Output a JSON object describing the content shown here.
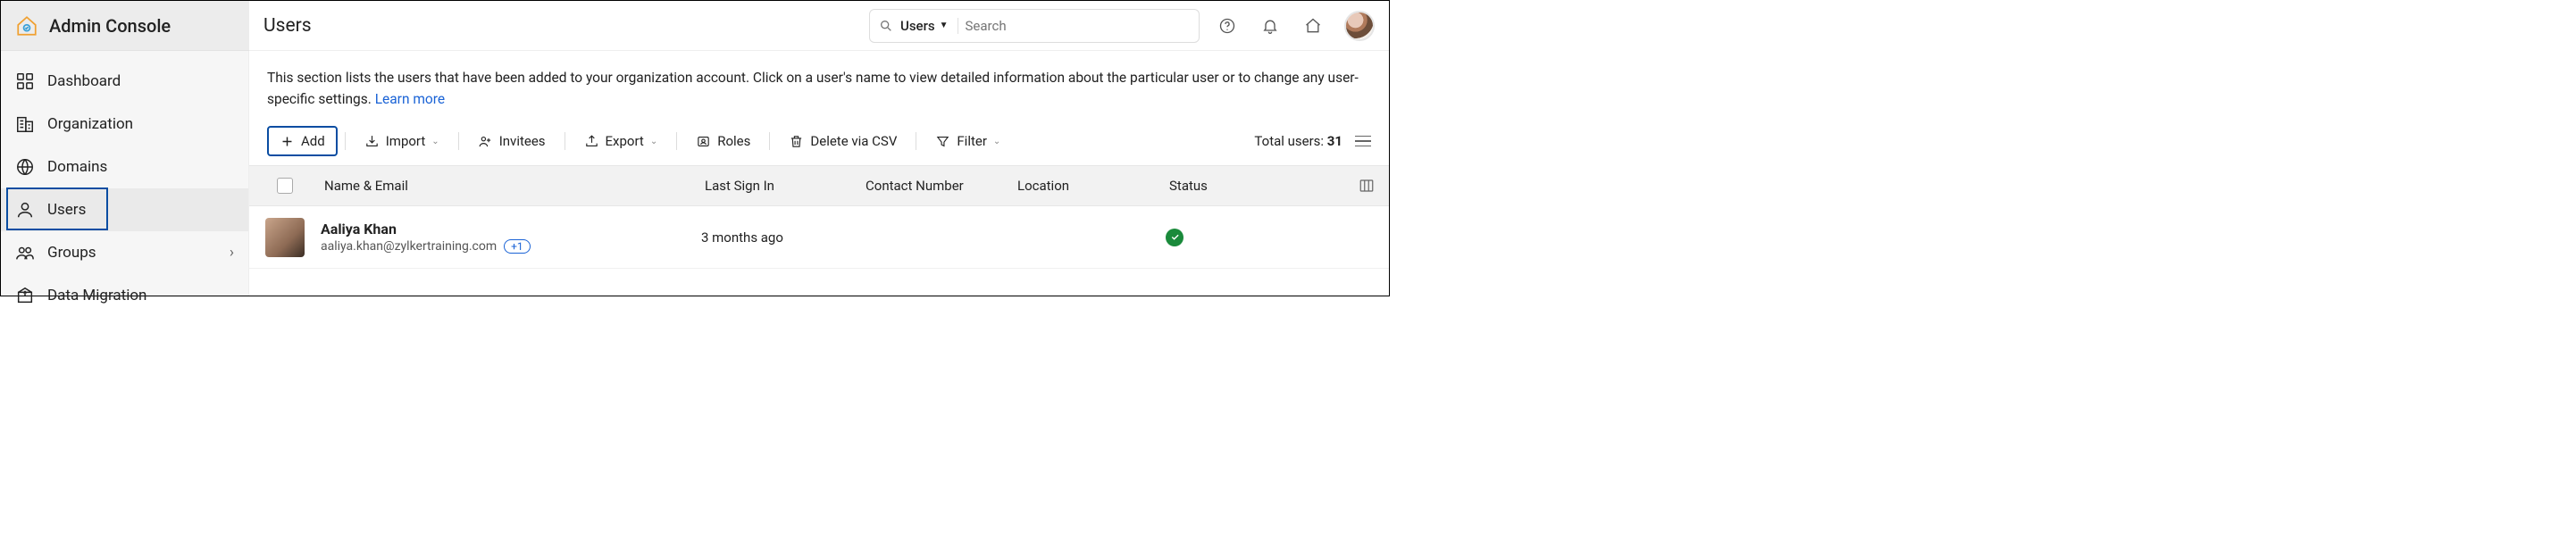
{
  "brand": {
    "title": "Admin Console"
  },
  "header": {
    "page_title": "Users",
    "search": {
      "category": "Users",
      "placeholder": "Search"
    }
  },
  "sidebar": {
    "items": [
      {
        "label": "Dashboard"
      },
      {
        "label": "Organization"
      },
      {
        "label": "Domains"
      },
      {
        "label": "Users"
      },
      {
        "label": "Groups"
      },
      {
        "label": "Data Migration"
      }
    ]
  },
  "intro": {
    "text": "This section lists the users that have been added to your organization account. Click on a user's name to view detailed information about the particular user or to change any user-specific settings.  ",
    "learn_more": "Learn more"
  },
  "toolbar": {
    "add": "Add",
    "import": "Import",
    "invitees": "Invitees",
    "export": "Export",
    "roles": "Roles",
    "delete_csv": "Delete via CSV",
    "filter": "Filter",
    "total_label": "Total users: ",
    "total_value": "31"
  },
  "table": {
    "columns": {
      "name_email": "Name & Email",
      "last_sign_in": "Last Sign In",
      "contact_number": "Contact Number",
      "location": "Location",
      "status": "Status"
    },
    "rows": [
      {
        "name": "Aaliya Khan",
        "email": "aaliya.khan@zylkertraining.com",
        "extra": "+1",
        "last_sign_in": "3 months ago",
        "contact_number": "",
        "location": "",
        "status": "active"
      }
    ]
  }
}
